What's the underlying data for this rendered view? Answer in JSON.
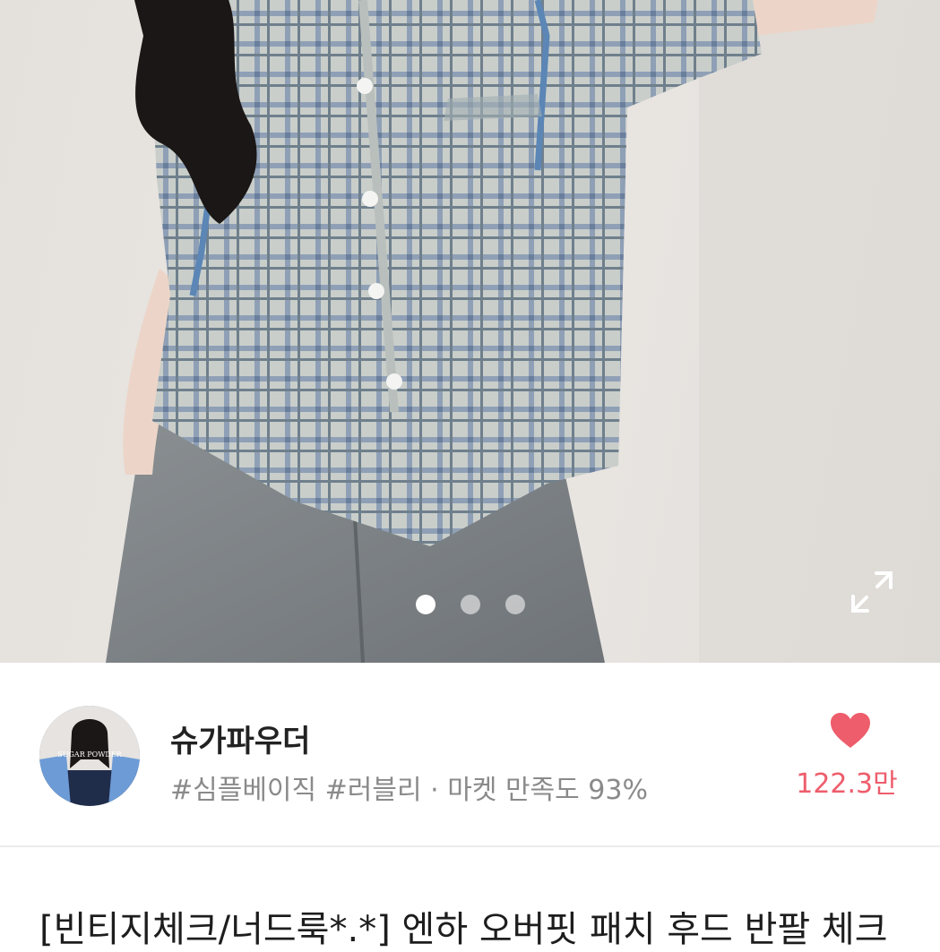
{
  "product_image": {
    "page_dots": 3,
    "active_index": 0
  },
  "icons": {
    "expand": "expand-icon",
    "heart": "heart-icon"
  },
  "seller": {
    "name": "슈가파우더",
    "tags": "#심플베이직 #러블리 · 마켓 만족도 93%",
    "avatar_text": "SUGAR POWDER"
  },
  "like": {
    "count": "122.3만"
  },
  "product": {
    "title": "[빈티지체크/너드룩*.*] 엔하 오버핏 패치 후드 반팔 체크"
  },
  "colors": {
    "accent": "#ee5d6c",
    "text_primary": "#222222",
    "text_secondary": "#8a8a8a"
  }
}
